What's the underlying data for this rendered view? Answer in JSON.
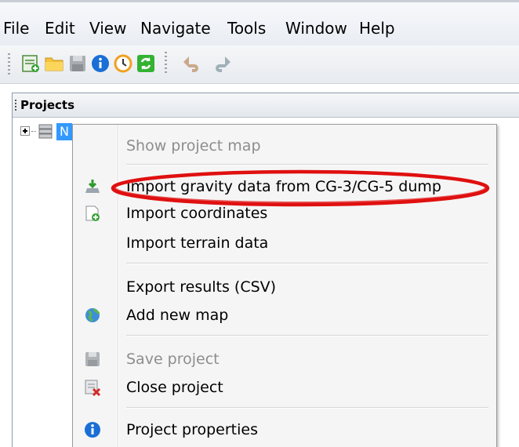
{
  "menubar": {
    "items": [
      "File",
      "Edit",
      "View",
      "Navigate",
      "Tools",
      "Window",
      "Help"
    ]
  },
  "toolbar": {
    "icons": [
      "new-project-icon",
      "open-folder-icon",
      "save-icon",
      "info-icon",
      "clock-icon",
      "refresh-icon",
      "undo-icon",
      "redo-icon"
    ]
  },
  "projects_panel": {
    "title": "Projects",
    "tree_item_label": "N"
  },
  "context_menu": {
    "items": [
      {
        "label": "Show project map",
        "enabled": false,
        "icon": ""
      },
      {
        "label": "Import gravity data from CG-3/CG-5 dump",
        "enabled": true,
        "icon": "import-gravity-icon"
      },
      {
        "label": "Import coordinates",
        "enabled": true,
        "icon": "import-coordinates-icon"
      },
      {
        "label": "Import terrain data",
        "enabled": true,
        "icon": ""
      },
      {
        "label": "Export results (CSV)",
        "enabled": true,
        "icon": ""
      },
      {
        "label": "Add new map",
        "enabled": true,
        "icon": "globe-add-icon"
      },
      {
        "label": "Save project",
        "enabled": false,
        "icon": "save-disk-icon"
      },
      {
        "label": "Close project",
        "enabled": true,
        "icon": "close-project-icon"
      },
      {
        "label": "Project properties",
        "enabled": true,
        "icon": "info-icon"
      }
    ]
  },
  "annotation": {
    "highlight_color": "#e01010",
    "highlight_target": "Import gravity data from CG-3/CG-5 dump"
  },
  "colors": {
    "selection": "#3399ff",
    "disabled_text": "#8d8d8d"
  }
}
